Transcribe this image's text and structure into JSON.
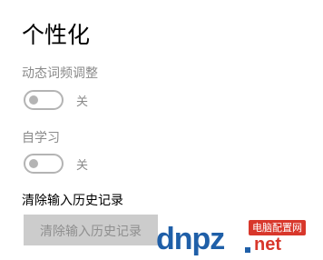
{
  "page": {
    "title": "个性化"
  },
  "settings": {
    "dynamic_frequency": {
      "label": "动态词频调整",
      "state_label": "关",
      "on": false
    },
    "self_learning": {
      "label": "自学习",
      "state_label": "关",
      "on": false
    },
    "clear_history": {
      "label": "清除输入历史记录",
      "button_label": "清除输入历史记录"
    }
  },
  "watermark": {
    "brand": "dnpz",
    "badge": "电脑配置网",
    "suffix": "net"
  },
  "colors": {
    "toggle_off": "#b4b4b4",
    "disabled_text": "#8a8a8a",
    "button_bg": "#cccccc",
    "watermark_blue": "#1f5fa8",
    "watermark_red": "#d8372b"
  },
  "icons": {
    "toggle": "toggle-switch-off-icon"
  }
}
